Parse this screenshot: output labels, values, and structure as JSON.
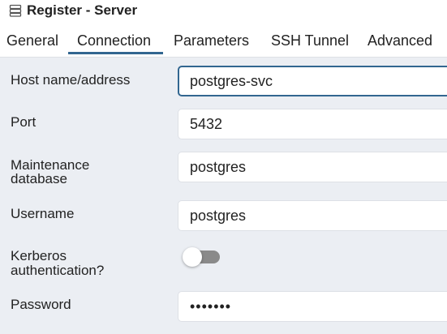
{
  "dialog": {
    "title": "Register - Server",
    "title_icon": "server-icon"
  },
  "tabs": [
    {
      "label": "General",
      "active": false
    },
    {
      "label": "Connection",
      "active": true
    },
    {
      "label": "Parameters",
      "active": false
    },
    {
      "label": "SSH Tunnel",
      "active": false
    },
    {
      "label": "Advanced",
      "active": false
    }
  ],
  "form": {
    "host": {
      "label": "Host name/address",
      "value": "postgres-svc"
    },
    "port": {
      "label": "Port",
      "value": "5432"
    },
    "maintenance_db": {
      "label_line1": "Maintenance",
      "label_line2": "database",
      "value": "postgres"
    },
    "username": {
      "label": "Username",
      "value": "postgres"
    },
    "kerberos": {
      "label_line1": "Kerberos",
      "label_line2": "authentication?",
      "enabled": false
    },
    "password": {
      "label": "Password",
      "value": "•••••••"
    }
  },
  "colors": {
    "accent": "#326690",
    "background": "#ebeef3",
    "field_border": "#dde0e6",
    "toggle_off": "#8a8a8a"
  }
}
